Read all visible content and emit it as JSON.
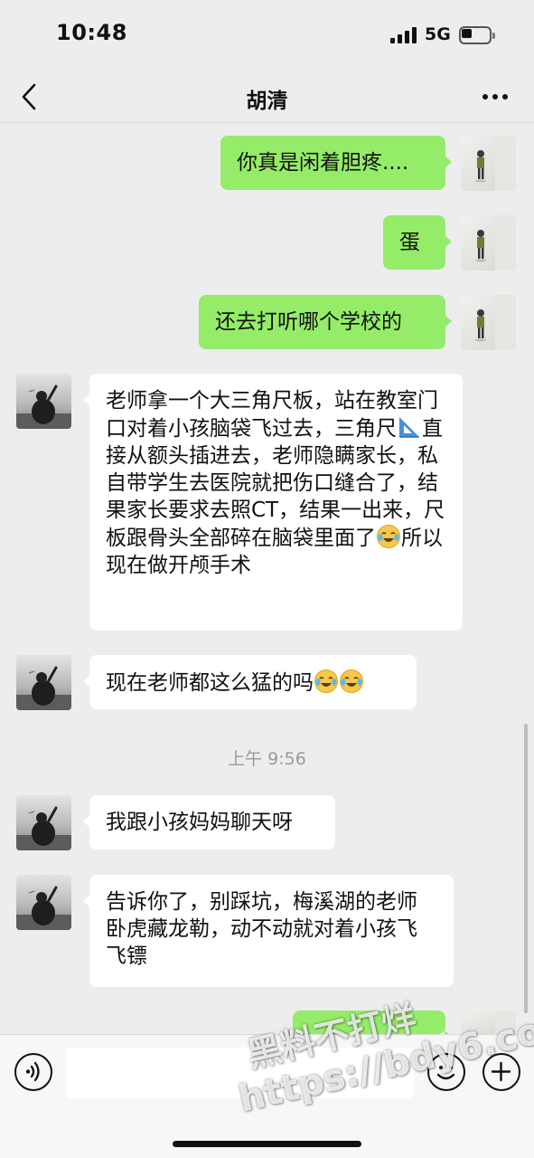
{
  "status_bar": {
    "time": "10:48",
    "network": "5G"
  },
  "header": {
    "title": "胡清"
  },
  "messages": [
    {
      "side": "right",
      "text": "你真是闲着胆疼...."
    },
    {
      "side": "right",
      "text": "蛋"
    },
    {
      "side": "right",
      "text": "还去打听哪个学校的"
    },
    {
      "side": "left",
      "text_part1": "老师拿一个大三角尺板，站在教室门口对着小孩脑袋飞过去，三角尺",
      "emoji_part1": "triangular-ruler-emoji",
      "text_part2": "直接从额头插进去，老师隐瞒家长，私自带学生去医院就把伤口缝合了，结果家长要求去照CT，结果一出来，尺板跟骨头全部碎在脑袋里面了",
      "emoji_part2": "crying-laughing-emoji",
      "text_part3": "所以现在做开颅手术"
    },
    {
      "side": "left",
      "text": "现在老师都这么猛的吗",
      "emojis": [
        "crying-laughing-emoji",
        "crying-laughing-emoji"
      ]
    },
    {
      "side": "left",
      "text": "我跟小孩妈妈聊天呀"
    },
    {
      "side": "left",
      "text": "告诉你了，别踩坑，梅溪湖的老师卧虎藏龙勒，动不动就对着小孩飞飞镖"
    }
  ],
  "timestamp": "上午 9:56",
  "input": {
    "placeholder": ""
  },
  "watermark": {
    "line1": "黑料不打烊",
    "line2": "https://bdy6.co"
  },
  "colors": {
    "background": "#ededed",
    "sent_bubble": "#95ec69",
    "received_bubble": "#ffffff"
  }
}
